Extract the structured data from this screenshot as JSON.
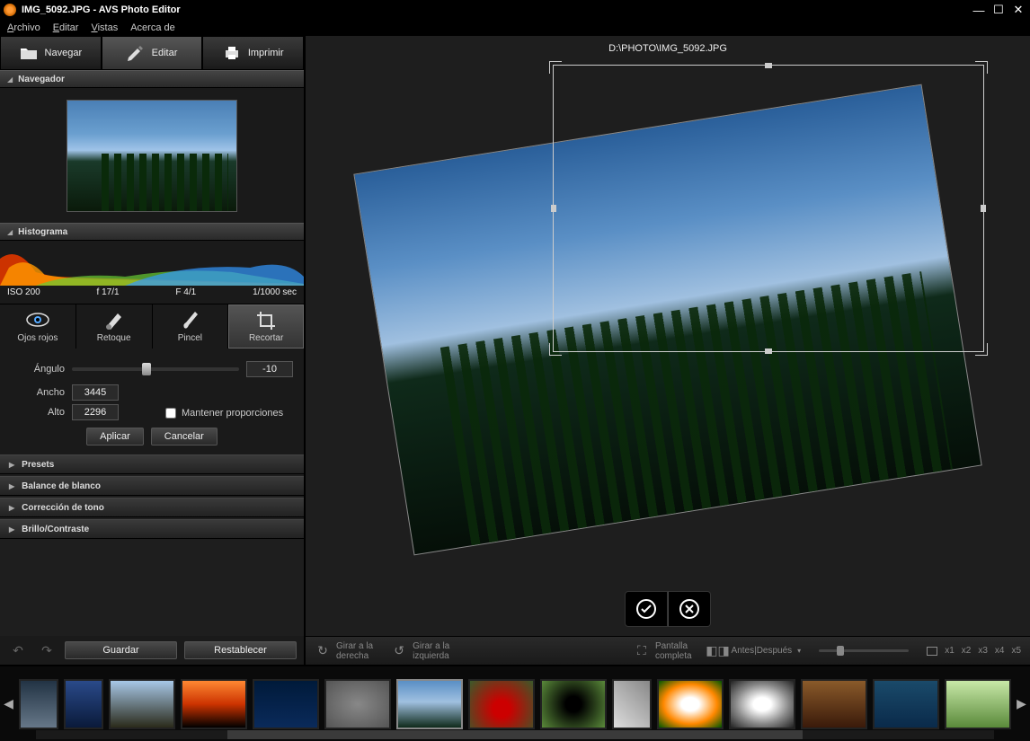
{
  "titlebar": {
    "title": "IMG_5092.JPG  -  AVS Photo Editor"
  },
  "menubar": {
    "archivo": "Archivo",
    "editar": "Editar",
    "vistas": "Vistas",
    "acerca": "Acerca de"
  },
  "tabs": {
    "browse": "Navegar",
    "edit": "Editar",
    "print": "Imprimir"
  },
  "panels": {
    "navigator": "Navegador",
    "histogram": "Histograma",
    "presets": "Presets",
    "white_balance": "Balance de blanco",
    "tone_correction": "Corrección de tono",
    "brightness_contrast": "Brillo/Contraste"
  },
  "histogram_info": {
    "iso": "ISO 200",
    "aperture1": "f 17/1",
    "aperture2": "F 4/1",
    "shutter": "1/1000 sec"
  },
  "tools": {
    "red_eye": "Ojos rojos",
    "retouch": "Retoque",
    "brush": "Pincel",
    "crop": "Recortar"
  },
  "crop": {
    "angle_label": "Ángulo",
    "angle_value": "-10",
    "width_label": "Ancho",
    "width_value": "3445",
    "height_label": "Alto",
    "height_value": "2296",
    "keep_proportions": "Mantener proporciones",
    "apply": "Aplicar",
    "cancel": "Cancelar"
  },
  "sidebar_footer": {
    "save": "Guardar",
    "reset": "Restablecer"
  },
  "filepath": "D:\\PHOTO\\IMG_5092.JPG",
  "bottom_toolbar": {
    "rotate_right_1": "Girar a la",
    "rotate_right_2": "derecha",
    "rotate_left_1": "Girar a la",
    "rotate_left_2": "izquierda",
    "fullscreen_1": "Pantalla",
    "fullscreen_2": "completa",
    "before_after": "Antes|Después",
    "zoom_x1": "x1",
    "zoom_x2": "x2",
    "zoom_x3": "x3",
    "zoom_x4": "x4",
    "zoom_x5": "x5"
  }
}
